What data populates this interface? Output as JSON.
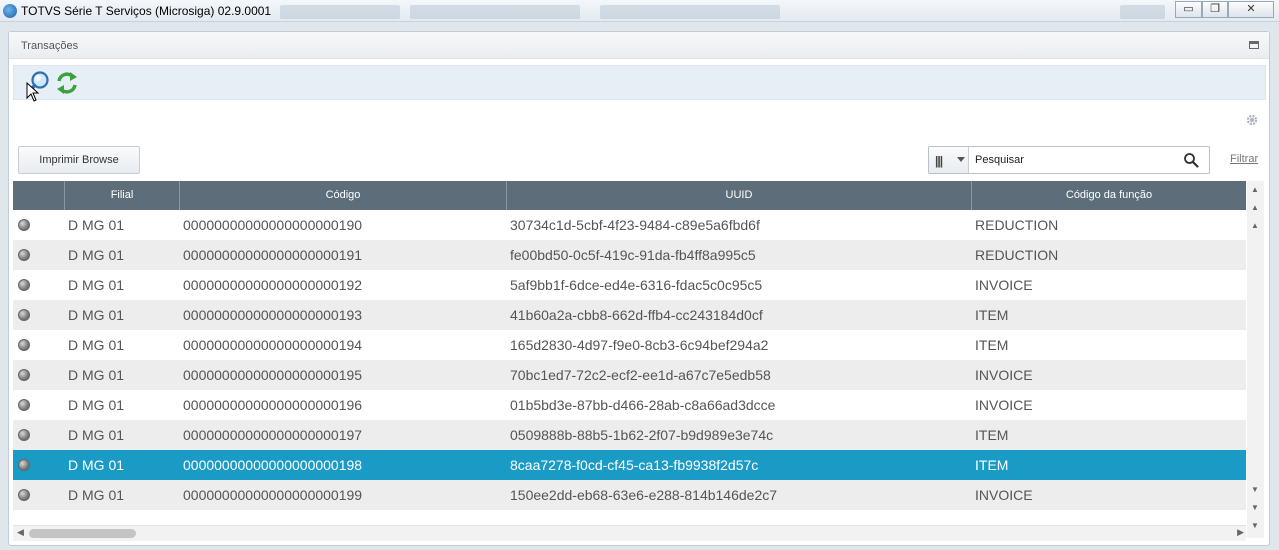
{
  "window": {
    "title": "TOTVS Série T Serviços (Microsiga) 02.9.0001",
    "minimize": "▭",
    "restore": "❐",
    "close": "✕"
  },
  "panel": {
    "title": "Transações"
  },
  "toolbar": {
    "search_icon": "search-icon",
    "refresh_icon": "refresh-icon"
  },
  "actions": {
    "print_label": "Imprimir Browse",
    "filter_label": "Filtrar"
  },
  "search": {
    "placeholder": "Pesquisar"
  },
  "grid": {
    "headers": [
      "Filial",
      "Código",
      "UUID",
      "Código da função"
    ],
    "rows": [
      {
        "filial": "D MG 01",
        "codigo": "00000000000000000000190",
        "uuid": "30734c1d-5cbf-4f23-9484-c89e5a6fbd6f",
        "funcao": "REDUCTION"
      },
      {
        "filial": "D MG 01",
        "codigo": "00000000000000000000191",
        "uuid": "fe00bd50-0c5f-419c-91da-fb4ff8a995c5",
        "funcao": "REDUCTION"
      },
      {
        "filial": "D MG 01",
        "codigo": "00000000000000000000192",
        "uuid": "5af9bb1f-6dce-ed4e-6316-fdac5c0c95c5",
        "funcao": "INVOICE"
      },
      {
        "filial": "D MG 01",
        "codigo": "00000000000000000000193",
        "uuid": "41b60a2a-cbb8-662d-ffb4-cc243184d0cf",
        "funcao": "ITEM"
      },
      {
        "filial": "D MG 01",
        "codigo": "00000000000000000000194",
        "uuid": "165d2830-4d97-f9e0-8cb3-6c94bef294a2",
        "funcao": "ITEM"
      },
      {
        "filial": "D MG 01",
        "codigo": "00000000000000000000195",
        "uuid": "70bc1ed7-72c2-ecf2-ee1d-a67c7e5edb58",
        "funcao": "INVOICE"
      },
      {
        "filial": "D MG 01",
        "codigo": "00000000000000000000196",
        "uuid": "01b5bd3e-87bb-d466-28ab-c8a66ad3dcce",
        "funcao": "INVOICE"
      },
      {
        "filial": "D MG 01",
        "codigo": "00000000000000000000197",
        "uuid": "0509888b-88b5-1b62-2f07-b9d989e3e74c",
        "funcao": "ITEM"
      },
      {
        "filial": "D MG 01",
        "codigo": "00000000000000000000198",
        "uuid": "8caa7278-f0cd-cf45-ca13-fb9938f2d57c",
        "funcao": "ITEM"
      },
      {
        "filial": "D MG 01",
        "codigo": "00000000000000000000199",
        "uuid": "150ee2dd-eb68-63e6-e288-814b146de2c7",
        "funcao": "INVOICE"
      }
    ],
    "selected_index": 8
  },
  "colors": {
    "header_bg": "#5d6e7a",
    "selected_row": "#1a9bc6",
    "toolbar_bg": "#e6eef6"
  }
}
